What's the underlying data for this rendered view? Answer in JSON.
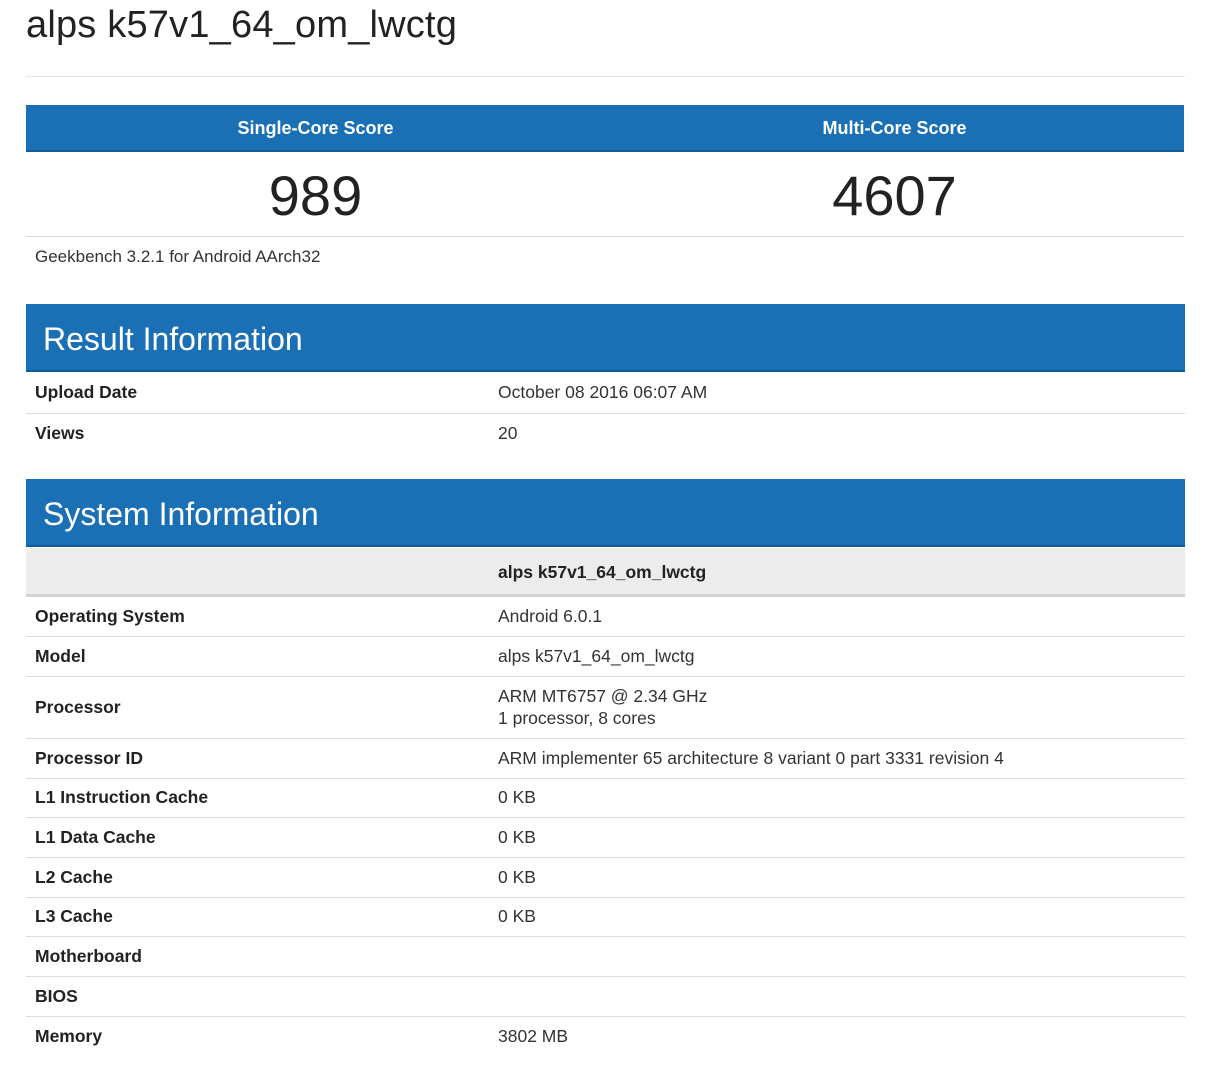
{
  "page": {
    "title": "alps k57v1_64_om_lwctg"
  },
  "scores": {
    "single_label": "Single-Core Score",
    "multi_label": "Multi-Core Score",
    "single_value": "989",
    "multi_value": "4607",
    "version": "Geekbench 3.2.1 for Android AArch32"
  },
  "result_info": {
    "heading": "Result Information",
    "rows": [
      {
        "label": "Upload Date",
        "value": "October 08 2016 06:07 AM"
      },
      {
        "label": "Views",
        "value": "20"
      }
    ]
  },
  "system_info": {
    "heading": "System Information",
    "device_column": "alps k57v1_64_om_lwctg",
    "rows": [
      {
        "label": "Operating System",
        "value": "Android 6.0.1"
      },
      {
        "label": "Model",
        "value": "alps k57v1_64_om_lwctg"
      },
      {
        "label": "Processor",
        "value": "ARM MT6757 @ 2.34 GHz",
        "value2": "1 processor, 8 cores"
      },
      {
        "label": "Processor ID",
        "value": "ARM implementer 65 architecture 8 variant 0 part 3331 revision 4"
      },
      {
        "label": "L1 Instruction Cache",
        "value": "0 KB"
      },
      {
        "label": "L1 Data Cache",
        "value": "0 KB"
      },
      {
        "label": "L2 Cache",
        "value": "0 KB"
      },
      {
        "label": "L3 Cache",
        "value": "0 KB"
      },
      {
        "label": "Motherboard",
        "value": ""
      },
      {
        "label": "BIOS",
        "value": ""
      },
      {
        "label": "Memory",
        "value": "3802 MB"
      }
    ]
  },
  "colors": {
    "accent": "#1a6fb5",
    "subheader_bg": "#ececec"
  }
}
